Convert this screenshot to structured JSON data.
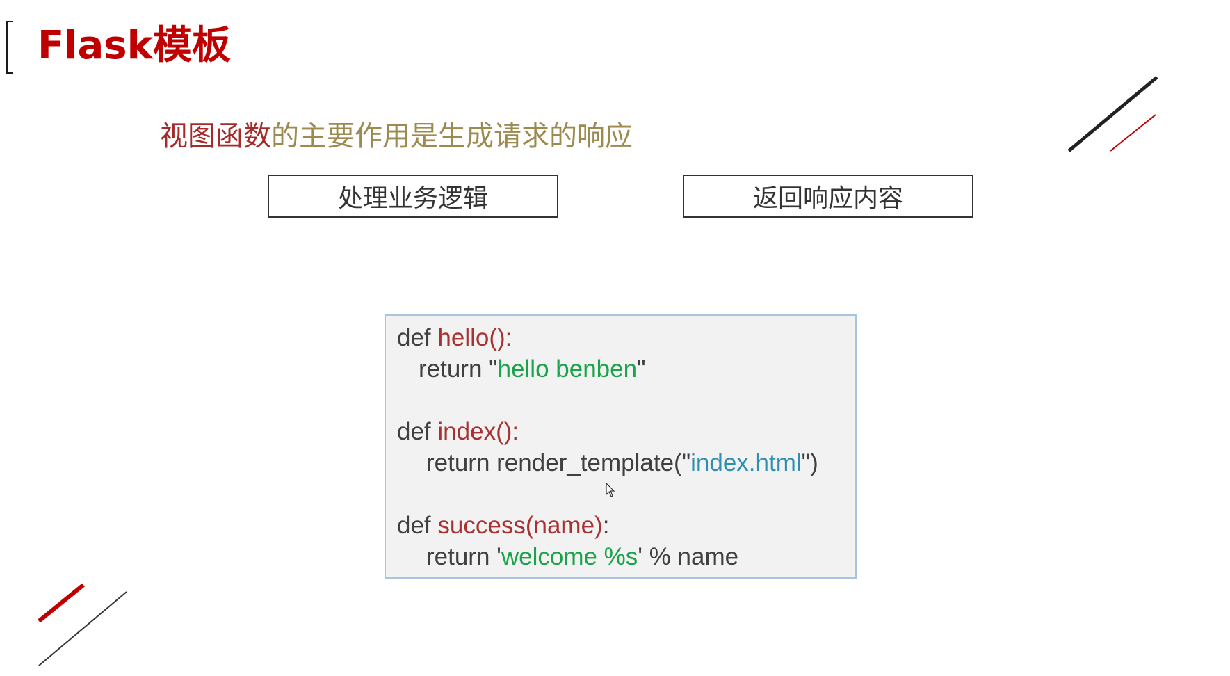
{
  "title": "Flask模板",
  "subtitle": {
    "accent": "视图函数",
    "rest": "的主要作用是生成请求的响应"
  },
  "boxes": {
    "left": "处理业务逻辑",
    "right": "返回响应内容"
  },
  "code": {
    "l1": {
      "kw": "def ",
      "fn": "hello():"
    },
    "l2": {
      "kw": "return \"",
      "str": "hello benben",
      "end": "\""
    },
    "l3": {
      "kw": "def ",
      "fn": "index():"
    },
    "l4": {
      "kw": "return render_template(\"",
      "str": "index.html",
      "end": "\")"
    },
    "l5": {
      "kw": "def ",
      "fn": "success(name)",
      "end": ":"
    },
    "l6": {
      "kw": "return '",
      "str": "welcome %s",
      "end": "' % name"
    }
  },
  "colors": {
    "title": "#c00000",
    "accent": "#a52a2a",
    "subtitle_rest": "#9c8a4e",
    "code_function": "#a83232",
    "code_string": "#1aa34a",
    "code_string_alt": "#2e8fb0",
    "code_border": "#a9c4df"
  },
  "icons": [
    "cursor-arrow-icon"
  ]
}
